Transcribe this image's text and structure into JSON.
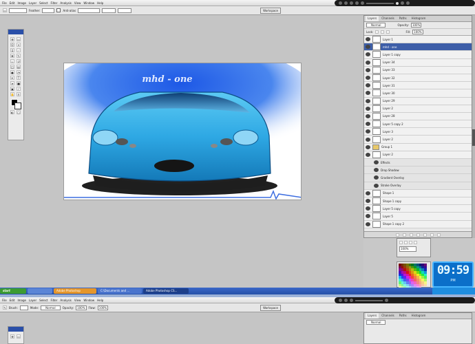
{
  "app": {
    "menus": [
      "File",
      "Edit",
      "Image",
      "Layer",
      "Select",
      "Filter",
      "Analysis",
      "View",
      "Window",
      "Help"
    ],
    "workspace_label": "Workspace"
  },
  "options_bar": {
    "mode_label": "New Selection",
    "style_label": "Normal",
    "feather_label": "Feather:",
    "feather_value": "0 px",
    "anti_alias_label": "Anti-alias",
    "refine_label": "Refine Edge..."
  },
  "second_options_bar": {
    "brush_label": "Brush:",
    "mode_label": "Mode:",
    "mode_value": "Normal",
    "opacity_label": "Opacity:",
    "opacity_value": "100%",
    "flow_label": "Flow:",
    "flow_value": "100%"
  },
  "canvas": {
    "artwork_text": "mhd - one"
  },
  "layers_panel": {
    "tabs": [
      "Layers",
      "Channels",
      "Paths",
      "Histogram"
    ],
    "blend_mode": "Normal",
    "opacity_label": "Opacity:",
    "opacity_value": "100%",
    "lock_label": "Lock:",
    "fill_label": "Fill:",
    "fill_value": "100%",
    "layers": [
      {
        "name": "Layer 1",
        "type": "normal"
      },
      {
        "name": "mhd - one",
        "type": "selected"
      },
      {
        "name": "Layer 1 copy",
        "type": "normal"
      },
      {
        "name": "Layer 34",
        "type": "normal"
      },
      {
        "name": "Layer 33",
        "type": "normal"
      },
      {
        "name": "Layer 32",
        "type": "normal"
      },
      {
        "name": "Layer 31",
        "type": "normal"
      },
      {
        "name": "Layer 30",
        "type": "normal"
      },
      {
        "name": "Layer 29",
        "type": "normal"
      },
      {
        "name": "Layer 2",
        "type": "normal"
      },
      {
        "name": "Layer 28",
        "type": "normal"
      },
      {
        "name": "Layer 5 copy 2",
        "type": "normal"
      },
      {
        "name": "Layer 3",
        "type": "normal"
      },
      {
        "name": "Layer 2",
        "type": "normal"
      },
      {
        "name": "Group 1",
        "type": "group"
      },
      {
        "name": "Layer 2",
        "type": "normal"
      },
      {
        "name": "Effects",
        "type": "sub"
      },
      {
        "name": "Drop Shadow",
        "type": "sub"
      },
      {
        "name": "Gradient Overlay",
        "type": "sub"
      },
      {
        "name": "Stroke Overlay",
        "type": "sub"
      },
      {
        "name": "Shape 1",
        "type": "normal"
      },
      {
        "name": "Shape 1 copy",
        "type": "normal"
      },
      {
        "name": "Layer 5 copy",
        "type": "normal"
      },
      {
        "name": "Layer 5",
        "type": "normal"
      },
      {
        "name": "Shape 1 copy 2",
        "type": "normal"
      },
      {
        "name": "Layer 4",
        "type": "normal"
      },
      {
        "name": "Layer 36",
        "type": "normal"
      },
      {
        "name": "Layer 36",
        "type": "normal"
      }
    ]
  },
  "navigator": {
    "zoom_value": "100%"
  },
  "clock": {
    "time": "09:59",
    "period": "PM"
  },
  "taskbar": {
    "start_label": "start",
    "buttons": [
      "Adobe Photoshop",
      "C:\\Documents and ...",
      "Adobe Photoshop CS..."
    ]
  },
  "colors": {
    "taskbar_blue": "#2b57b5",
    "start_green": "#3c9b32",
    "car_blue": "#2ea8e4",
    "highlight_blue": "#3d5ea8",
    "clock_blue": "#0b6fc9"
  }
}
